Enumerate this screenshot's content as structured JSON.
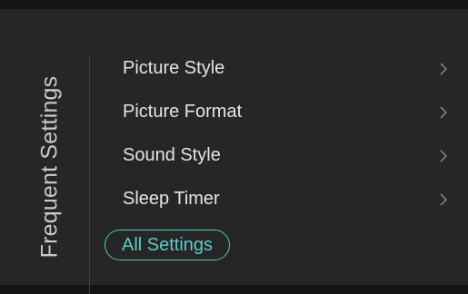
{
  "menu": {
    "title": "Frequent Settings",
    "items": [
      {
        "label": "Picture Style",
        "icon": "chevron-right-icon"
      },
      {
        "label": "Picture Format",
        "icon": "chevron-right-icon"
      },
      {
        "label": "Sound Style",
        "icon": "chevron-right-icon"
      },
      {
        "label": "Sleep Timer",
        "icon": "chevron-right-icon"
      }
    ],
    "all_settings_label": "All Settings"
  },
  "colors": {
    "background": "#262626",
    "text": "#e4e4e4",
    "title_text": "#c9c9c9",
    "accent": "#59cfc6",
    "chevron": "#8a8a8a"
  }
}
